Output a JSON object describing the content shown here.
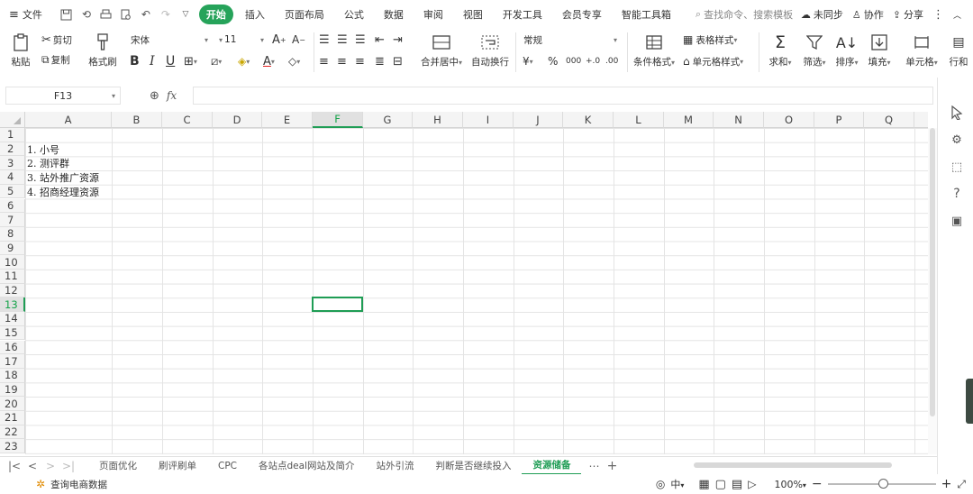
{
  "menubar": {
    "file": "文件",
    "tabs": [
      {
        "label": "开始",
        "active": true
      },
      {
        "label": "插入"
      },
      {
        "label": "页面布局"
      },
      {
        "label": "公式"
      },
      {
        "label": "数据"
      },
      {
        "label": "审阅"
      },
      {
        "label": "视图"
      },
      {
        "label": "开发工具"
      },
      {
        "label": "会员专享"
      },
      {
        "label": "智能工具箱"
      }
    ],
    "search_placeholder": "查找命令、搜索模板",
    "sync": "未同步",
    "collab": "协作",
    "share": "分享",
    "accent": "#26a35a"
  },
  "ribbon": {
    "paste": "粘贴",
    "cut": "剪切",
    "copy": "复制",
    "format_painter": "格式刷",
    "font_name": "宋体",
    "font_size": "11",
    "merge_center": "合并居中",
    "wrap_text": "自动换行",
    "number_format": "常规",
    "conditional_format": "条件格式",
    "table_style": "表格样式",
    "cell_style": "单元格样式",
    "sum": "求和",
    "filter": "筛选",
    "sort": "排序",
    "fill": "填充",
    "cell": "单元格",
    "row_col": "行和"
  },
  "formula_bar": {
    "cell_ref": "F13",
    "fx": "fx",
    "formula": ""
  },
  "grid": {
    "columns": [
      "A",
      "B",
      "C",
      "D",
      "E",
      "F",
      "G",
      "H",
      "I",
      "J",
      "K",
      "L",
      "M",
      "N",
      "O",
      "P",
      "Q"
    ],
    "rows": [
      "1",
      "2",
      "3",
      "4",
      "5",
      "6",
      "7",
      "8",
      "9",
      "10",
      "11",
      "12",
      "13",
      "14",
      "15",
      "16",
      "17",
      "18",
      "19",
      "20",
      "21",
      "22",
      "23"
    ],
    "selected_col": "F",
    "selected_row": "13",
    "cells": {
      "A2": "1. 小号",
      "A3": "2. 测评群",
      "A4": "3. 站外推广资源",
      "A5": "4. 招商经理资源"
    }
  },
  "sheet_tabs": [
    {
      "label": "页面优化"
    },
    {
      "label": "刷评刷单"
    },
    {
      "label": "CPC"
    },
    {
      "label": "各站点deal网站及简介"
    },
    {
      "label": "站外引流"
    },
    {
      "label": "判断是否继续投入"
    },
    {
      "label": "资源储备",
      "active": true
    }
  ],
  "status": {
    "left_label": "查询电商数据",
    "zoom": "100%"
  }
}
